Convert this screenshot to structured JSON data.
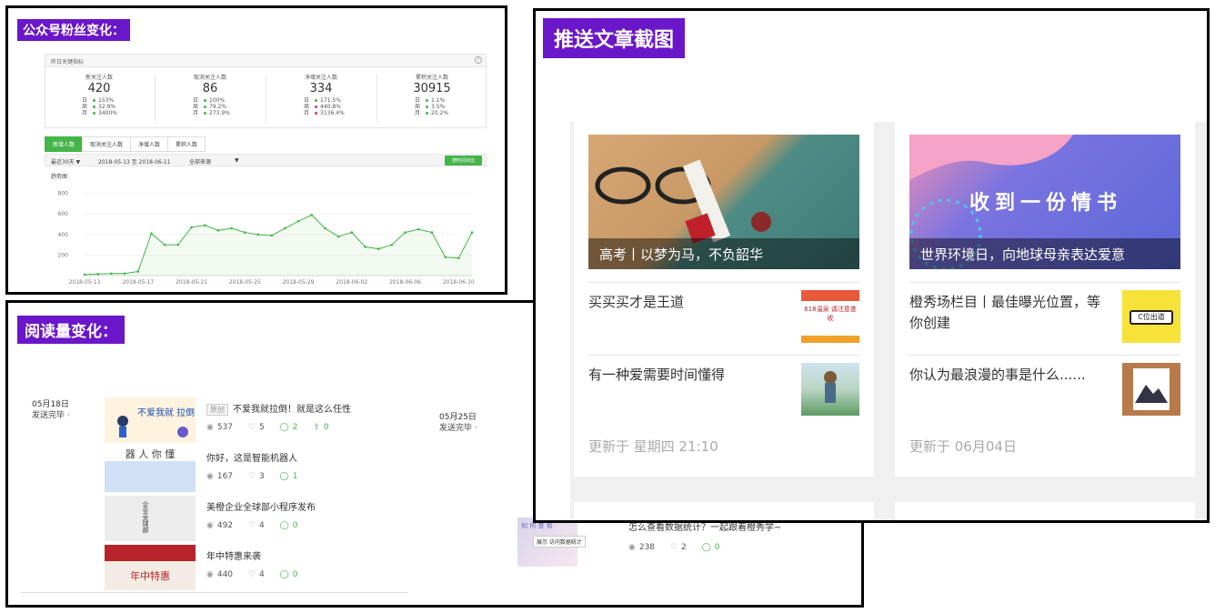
{
  "fans": {
    "tag": "公众号粉丝变化：",
    "card_title": "昨日关键指标",
    "help": "?",
    "metrics": [
      {
        "title": "新关注人数",
        "value": "420",
        "rows": [
          {
            "k": "日",
            "v": "153%",
            "dir": "up"
          },
          {
            "k": "周",
            "v": "32.9%",
            "dir": "up"
          },
          {
            "k": "月",
            "v": "3400%",
            "dir": "up"
          }
        ]
      },
      {
        "title": "取消关注人数",
        "value": "86",
        "rows": [
          {
            "k": "日",
            "v": "100%",
            "dir": "up"
          },
          {
            "k": "周",
            "v": "79.2%",
            "dir": "up"
          },
          {
            "k": "月",
            "v": "273.9%",
            "dir": "up"
          }
        ]
      },
      {
        "title": "净增关注人数",
        "value": "334",
        "rows": [
          {
            "k": "日",
            "v": "171.5%",
            "dir": "up"
          },
          {
            "k": "周",
            "v": "440.8%",
            "dir": "down"
          },
          {
            "k": "月",
            "v": "3136.4%",
            "dir": "down"
          }
        ]
      },
      {
        "title": "累积关注人数",
        "value": "30915",
        "rows": [
          {
            "k": "日",
            "v": "1.1%",
            "dir": "up"
          },
          {
            "k": "周",
            "v": "3.5%",
            "dir": "up"
          },
          {
            "k": "月",
            "v": "20.2%",
            "dir": "up"
          }
        ]
      }
    ],
    "tabs": [
      "新增人数",
      "取消关注人数",
      "净增人数",
      "累积人数"
    ],
    "filter": {
      "range": "最近30天 ▼",
      "dates": "2018-05-13 至 2018-06-11",
      "source": "全部来源",
      "source_caret": "▼",
      "compare": "按时间对比"
    },
    "chart_label": "趋势图"
  },
  "chart_data": {
    "type": "line",
    "x": [
      "2018-05-13",
      "2018-05-14",
      "2018-05-15",
      "2018-05-16",
      "2018-05-17",
      "2018-05-18",
      "2018-05-19",
      "2018-05-20",
      "2018-05-21",
      "2018-05-22",
      "2018-05-23",
      "2018-05-24",
      "2018-05-25",
      "2018-05-26",
      "2018-05-27",
      "2018-05-28",
      "2018-05-29",
      "2018-05-30",
      "2018-05-31",
      "2018-06-01",
      "2018-06-02",
      "2018-06-03",
      "2018-06-04",
      "2018-06-05",
      "2018-06-06",
      "2018-06-07",
      "2018-06-08",
      "2018-06-09",
      "2018-06-10",
      "2018-06-11"
    ],
    "xticks": [
      "2018-05-13",
      "2018-05-17",
      "2018-05-21",
      "2018-05-25",
      "2018-05-29",
      "2018-06-02",
      "2018-06-06",
      "2018-06-10"
    ],
    "series": [
      {
        "values": [
          10,
          15,
          20,
          20,
          40,
          410,
          300,
          300,
          470,
          490,
          440,
          460,
          420,
          400,
          390,
          460,
          530,
          590,
          460,
          380,
          420,
          280,
          260,
          300,
          420,
          450,
          420,
          180,
          170,
          420
        ]
      }
    ],
    "yticks": [
      200,
      400,
      600,
      800
    ],
    "ylim": [
      0,
      850
    ],
    "grid": true,
    "color": "#44b549"
  },
  "reads": {
    "tag": "阅读量变化：",
    "date1": {
      "date": "05月18日",
      "status": "发送完毕 ·"
    },
    "date2": {
      "date": "05月25日",
      "status": "发送完毕 ·"
    },
    "original_badge": "原创",
    "articles": [
      {
        "title": "不爱我就拉倒！就是这么任性",
        "views": "537",
        "likes": "5",
        "comments": "2",
        "shares": "0",
        "thumb_text": "不爱我就 拉倒"
      },
      {
        "title": "你好，这是智能机器人",
        "views": "167",
        "likes": "3",
        "comments": "1",
        "thumb_text": "器 人 你 懂"
      },
      {
        "title": "美橙企业全球部小程序发布",
        "views": "492",
        "likes": "4",
        "comments": "0",
        "thumb_text": "企业全球部"
      },
      {
        "title": "年中特惠来袭",
        "views": "440",
        "likes": "4",
        "comments": "0",
        "thumb_text": "年中特惠"
      },
      {
        "title": "怎么查看数据统计？一起跟着橙秀学~",
        "views": "238",
        "likes": "2",
        "comments": "0",
        "thumb_text": "如 何 查 看"
      }
    ],
    "tooltip": "展示 访问数据统计"
  },
  "push": {
    "tag": "推送文章截图",
    "cards": [
      {
        "cover_title": "高考丨以梦为马，不负韶华",
        "items": [
          "买买买才是王道",
          "有一种爱需要时间懂得"
        ],
        "thumb_texts": [
          "618温泉 请注意查收"
        ],
        "updated": "更新于 星期四 21:10"
      },
      {
        "cover_title": "世界环境日，向地球母亲表达爱意",
        "cover_text": "收到一份情书",
        "items": [
          "橙秀场栏目丨最佳曝光位置，等你创建",
          "你认为最浪漫的事是什么......"
        ],
        "thumb_texts": [
          "C位出道"
        ],
        "updated": "更新于 06月04日"
      }
    ]
  },
  "colors": {
    "tag_bg": "#6a16c9",
    "wechat_green": "#44b549",
    "down_red": "#e23d3d"
  }
}
